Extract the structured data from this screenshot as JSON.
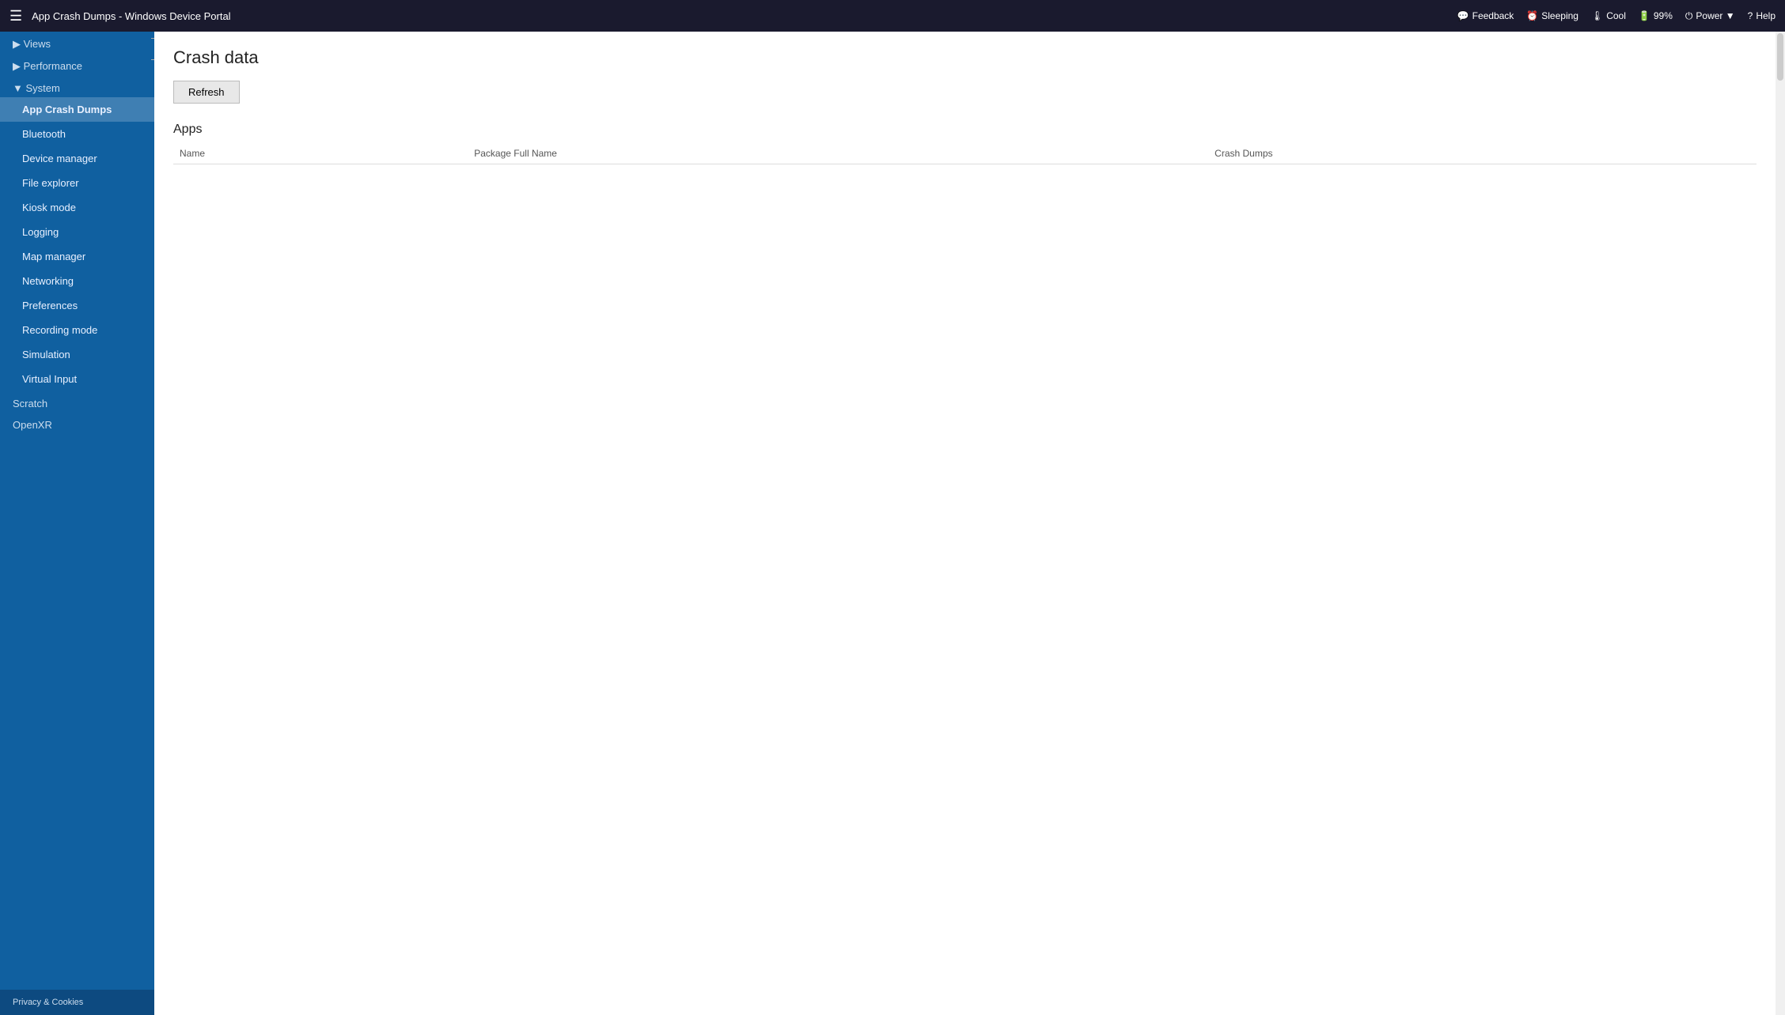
{
  "topbar": {
    "hamburger": "☰",
    "title": "App Crash Dumps - Windows Device Portal",
    "actions": [
      {
        "id": "feedback",
        "icon": "💬",
        "label": "Feedback"
      },
      {
        "id": "sleeping",
        "icon": "⏰",
        "label": "Sleeping"
      },
      {
        "id": "cool",
        "icon": "🌡",
        "label": "Cool"
      },
      {
        "id": "battery",
        "icon": "🔋",
        "label": "99%"
      },
      {
        "id": "power",
        "icon": "⏻",
        "label": "Power ▼"
      },
      {
        "id": "help",
        "icon": "?",
        "label": "Help"
      }
    ]
  },
  "sidebar": {
    "collapse_icon": "◀",
    "sections": [
      {
        "id": "views",
        "label": "▶ Views",
        "type": "section"
      },
      {
        "id": "performance",
        "label": "▶ Performance",
        "type": "section"
      },
      {
        "id": "system",
        "label": "▼ System",
        "type": "section"
      },
      {
        "id": "app-crash-dumps",
        "label": "App Crash Dumps",
        "type": "item",
        "active": true
      },
      {
        "id": "bluetooth",
        "label": "Bluetooth",
        "type": "item"
      },
      {
        "id": "device-manager",
        "label": "Device manager",
        "type": "item"
      },
      {
        "id": "file-explorer",
        "label": "File explorer",
        "type": "item"
      },
      {
        "id": "kiosk-mode",
        "label": "Kiosk mode",
        "type": "item"
      },
      {
        "id": "logging",
        "label": "Logging",
        "type": "item"
      },
      {
        "id": "map-manager",
        "label": "Map manager",
        "type": "item"
      },
      {
        "id": "networking",
        "label": "Networking",
        "type": "item"
      },
      {
        "id": "preferences",
        "label": "Preferences",
        "type": "item"
      },
      {
        "id": "recording-mode",
        "label": "Recording mode",
        "type": "item"
      },
      {
        "id": "simulation",
        "label": "Simulation",
        "type": "item"
      },
      {
        "id": "virtual-input",
        "label": "Virtual Input",
        "type": "item"
      },
      {
        "id": "scratch",
        "label": "Scratch",
        "type": "section"
      },
      {
        "id": "openxr",
        "label": "OpenXR",
        "type": "section"
      }
    ],
    "footer": "Privacy & Cookies"
  },
  "content": {
    "page_title": "Crash data",
    "refresh_button": "Refresh",
    "apps_section_title": "Apps",
    "table_columns": [
      "Name",
      "Package Full Name",
      "Crash Dumps"
    ]
  }
}
